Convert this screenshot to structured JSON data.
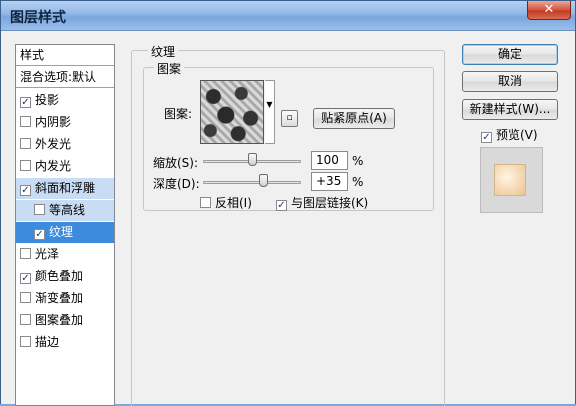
{
  "window": {
    "title": "图层样式",
    "close_glyph": "✕"
  },
  "style_list": {
    "header": "样式",
    "blend_options": "混合选项:默认",
    "items": [
      {
        "label": "投影",
        "checked": true,
        "state": "normal"
      },
      {
        "label": "内阴影",
        "checked": false,
        "state": "normal"
      },
      {
        "label": "外发光",
        "checked": false,
        "state": "normal"
      },
      {
        "label": "内发光",
        "checked": false,
        "state": "normal"
      },
      {
        "label": "斜面和浮雕",
        "checked": true,
        "state": "highlight"
      },
      {
        "label": "等高线",
        "checked": false,
        "state": "highlight-sub"
      },
      {
        "label": "纹理",
        "checked": true,
        "state": "selected-sub"
      },
      {
        "label": "光泽",
        "checked": false,
        "state": "normal"
      },
      {
        "label": "颜色叠加",
        "checked": true,
        "state": "normal"
      },
      {
        "label": "渐变叠加",
        "checked": false,
        "state": "normal"
      },
      {
        "label": "图案叠加",
        "checked": false,
        "state": "normal"
      },
      {
        "label": "描边",
        "checked": false,
        "state": "normal"
      }
    ]
  },
  "texture": {
    "group_title": "纹理",
    "pattern_group_title": "图案",
    "pattern_label": "图案:",
    "new_preset_glyph": "▫",
    "snap_button": "贴紧原点(A)",
    "scale_label": "缩放(S):",
    "scale_value": "100",
    "scale_fraction": 0.5,
    "depth_label": "深度(D):",
    "depth_value": "+35",
    "depth_fraction": 0.62,
    "unit": "%",
    "invert_label": "反相(I)",
    "invert_checked": false,
    "link_label": "与图层链接(K)",
    "link_checked": true
  },
  "buttons": {
    "ok": "确定",
    "cancel": "取消",
    "new_style": "新建样式(W)...",
    "preview_label": "预览(V)",
    "preview_checked": true
  },
  "colors": {
    "selection": "#3d8bdd",
    "highlight": "#c8dcf4",
    "titlebar": "#8fb6e6",
    "close_button": "#c23a22"
  }
}
